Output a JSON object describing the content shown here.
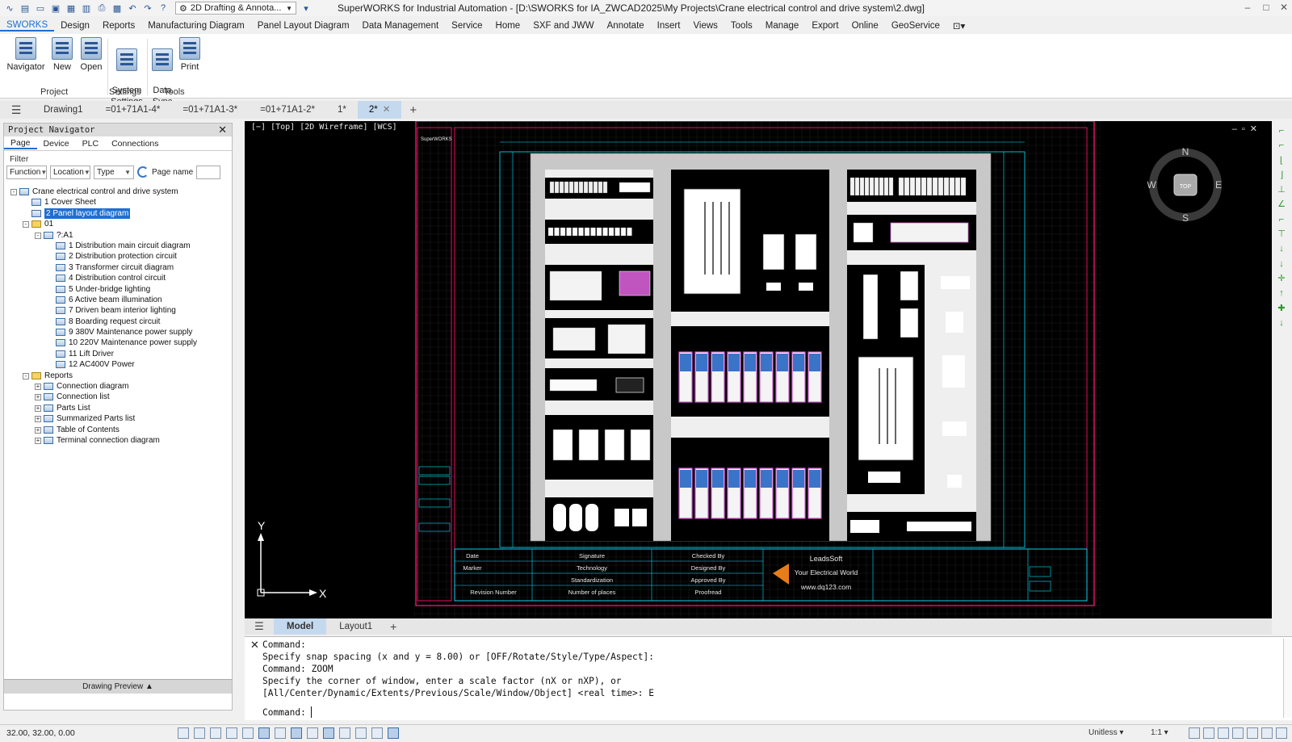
{
  "titlebar": {
    "workspace": "2D Drafting & Annota...",
    "title": "SuperWORKS for Industrial Automation - [D:\\SWORKS for IA_ZWCAD2025\\My Projects\\Crane electrical control and drive system\\2.dwg]"
  },
  "menu": [
    "SWORKS",
    "Design",
    "Reports",
    "Manufacturing Diagram",
    "Panel Layout Diagram",
    "Data Management",
    "Service",
    "Home",
    "SXF and JWW",
    "Annotate",
    "Insert",
    "Views",
    "Tools",
    "Manage",
    "Export",
    "Online",
    "GeoService"
  ],
  "ribbon": {
    "buttons": [
      {
        "label": "Navigator",
        "icon": "navigator-icon"
      },
      {
        "label": "New",
        "icon": "new-project-icon"
      },
      {
        "label": "Open",
        "icon": "open-project-icon"
      },
      {
        "label": "System\nSettings",
        "icon": "system-settings-icon"
      },
      {
        "label": "Data\nSync",
        "icon": "data-sync-icon"
      },
      {
        "label": "Print",
        "icon": "print-icon"
      }
    ],
    "groups": [
      "Project",
      "Settings",
      "Tools"
    ]
  },
  "doc_tabs": [
    "Drawing1",
    "=01+71A1-4*",
    "=01+71A1-3*",
    "=01+71A1-2*",
    "1*",
    "2*"
  ],
  "nav": {
    "title": "Project Navigator",
    "tabs": [
      "Page",
      "Device",
      "PLC",
      "Connections"
    ],
    "filter_label": "Filter",
    "filters": [
      "Function",
      "Location",
      "Type"
    ],
    "page_name_label": "Page name",
    "tree": [
      {
        "label": "Crane electrical control and drive system",
        "level": 0,
        "exp": "-",
        "icon": "project"
      },
      {
        "label": "1 Cover Sheet",
        "level": 1,
        "icon": "page"
      },
      {
        "label": "2 Panel layout diagram",
        "level": 1,
        "icon": "page",
        "selected": true
      },
      {
        "label": "01",
        "level": 1,
        "exp": "-",
        "icon": "folder"
      },
      {
        "label": "?:A1",
        "level": 2,
        "exp": "-",
        "icon": "group"
      },
      {
        "label": "1 Distribution main circuit diagram",
        "level": 3,
        "icon": "page"
      },
      {
        "label": "2 Distribution protection circuit",
        "level": 3,
        "icon": "page"
      },
      {
        "label": "3 Transformer circuit diagram",
        "level": 3,
        "icon": "page"
      },
      {
        "label": "4 Distribution control circuit",
        "level": 3,
        "icon": "page"
      },
      {
        "label": "5 Under-bridge lighting",
        "level": 3,
        "icon": "page"
      },
      {
        "label": "6 Active beam illumination",
        "level": 3,
        "icon": "page"
      },
      {
        "label": "7 Driven beam interior lighting",
        "level": 3,
        "icon": "page"
      },
      {
        "label": "8 Boarding request circuit",
        "level": 3,
        "icon": "page"
      },
      {
        "label": "9 380V Maintenance power supply",
        "level": 3,
        "icon": "page"
      },
      {
        "label": "10 220V Maintenance power supply",
        "level": 3,
        "icon": "page"
      },
      {
        "label": "11 Lift Driver",
        "level": 3,
        "icon": "page"
      },
      {
        "label": "12 AC400V Power",
        "level": 3,
        "icon": "page"
      },
      {
        "label": "Reports",
        "level": 1,
        "exp": "-",
        "icon": "folder"
      },
      {
        "label": "Connection diagram",
        "level": 2,
        "exp": "+",
        "icon": "group"
      },
      {
        "label": "Connection list",
        "level": 2,
        "exp": "+",
        "icon": "group"
      },
      {
        "label": "Parts List",
        "level": 2,
        "exp": "+",
        "icon": "group"
      },
      {
        "label": "Summarized Parts list",
        "level": 2,
        "exp": "+",
        "icon": "group"
      },
      {
        "label": "Table of Contents",
        "level": 2,
        "exp": "+",
        "icon": "group"
      },
      {
        "label": "Terminal connection diagram",
        "level": 2,
        "exp": "+",
        "icon": "group"
      }
    ],
    "preview": "Drawing Preview ▲"
  },
  "canvas": {
    "view_label": "[−] [Top] [2D Wireframe] [WCS]",
    "compass": {
      "n": "N",
      "s": "S",
      "e": "E",
      "w": "W",
      "top": "TOP"
    },
    "ucs": {
      "x": "X",
      "y": "Y"
    },
    "logo": "SuperWORKS",
    "title_block": {
      "date": "Date",
      "marker": "Marker",
      "revision": "Revision Number",
      "signature": "Signature",
      "technology": "Technology",
      "standardization": "Standardization",
      "places": "Number of places",
      "checked": "Checked By",
      "designed": "Designed By",
      "approved": "Approved By",
      "proofread": "Proofread",
      "company": "LeadsSoft",
      "slogan": "Your Electrical World",
      "url": "www.dq123.com"
    }
  },
  "layout_tabs": [
    "Model",
    "Layout1"
  ],
  "command": {
    "history": [
      "Command:",
      "Specify snap spacing (x and y = 8.00) or [OFF/Rotate/Style/Type/Aspect]:",
      "Command: ZOOM",
      "Specify the corner of window, enter a scale factor (nX or nXP), or",
      "[All/Center/Dynamic/Extents/Previous/Scale/Window/Object] <real time>: E"
    ],
    "prompt": "Command:"
  },
  "status": {
    "coords": "32.00,  32.00,  0.00",
    "units": "Unitless",
    "scale": "1:1"
  },
  "colors": {
    "frame": "#e0115f",
    "cyan": "#00e5ff",
    "panel": "#c8c8c8",
    "accent": "#1f6fd1"
  }
}
